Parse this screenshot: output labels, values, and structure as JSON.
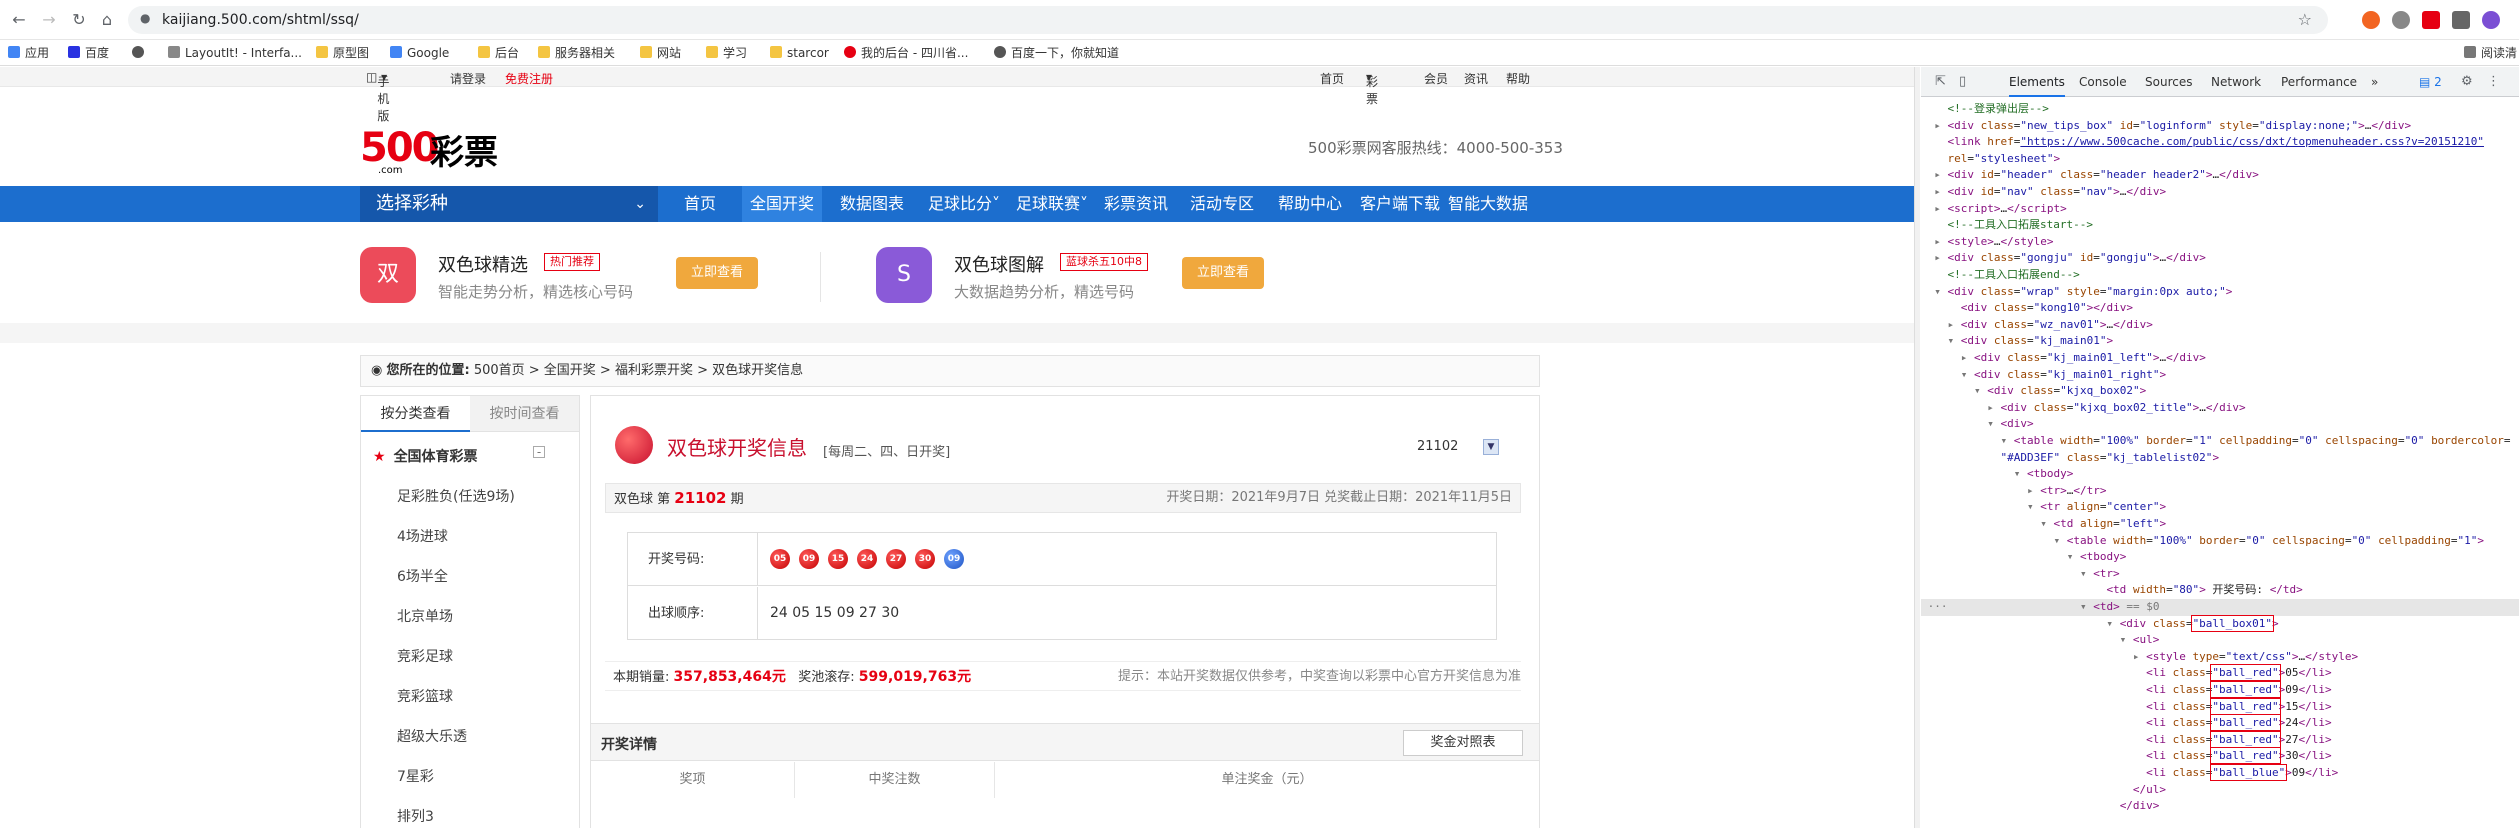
{
  "browser": {
    "url": "kaijiang.500.com/shtml/ssq/",
    "bookmarks": [
      {
        "label": "应用",
        "color": "#4285f4"
      },
      {
        "label": "百度",
        "color": "#2932e1"
      },
      {
        "label": "",
        "color": "#555555"
      },
      {
        "label": "LayoutIt! - Interfa...",
        "color": "#888888"
      },
      {
        "label": "原型图",
        "color": "#f4c542"
      },
      {
        "label": "Google",
        "color": "#4285f4"
      },
      {
        "label": "后台",
        "color": "#f4c542"
      },
      {
        "label": "服务器相关",
        "color": "#f4c542"
      },
      {
        "label": "网站",
        "color": "#f4c542"
      },
      {
        "label": "学习",
        "color": "#f4c542"
      },
      {
        "label": "starcor",
        "color": "#f4c542"
      },
      {
        "label": "我的后台 - 四川省...",
        "color": "#e60012"
      },
      {
        "label": "百度一下，你就知道",
        "color": "#555555"
      },
      {
        "label": "阅读清",
        "color": "#777777"
      }
    ]
  },
  "site": {
    "topbar": {
      "mobile": "手机版",
      "login": "请登录",
      "register": "免费注册",
      "links": [
        "首页",
        "彩票",
        "会员",
        "资讯",
        "帮助"
      ]
    },
    "logo_num": "500",
    "logo_com": ".com",
    "logo_text": "彩票",
    "hotline": "500彩票网客服热线：4000-500-353",
    "nav": {
      "select_label": "选择彩种",
      "items": [
        "首页",
        "全国开奖",
        "数据图表",
        "足球比分",
        "足球联赛",
        "彩票资讯",
        "活动专区",
        "帮助中心",
        "客户端下载",
        "智能大数据"
      ]
    },
    "promos": [
      {
        "title": "双色球精选",
        "tag": "热门推荐",
        "desc": "智能走势分析，精选核心号码",
        "button": "立即查看",
        "icon": "双"
      },
      {
        "title": "双色球图解",
        "tag": "蓝球杀五10中8",
        "desc": "大数据趋势分析，精选号码",
        "button": "立即查看",
        "icon": "S"
      }
    ],
    "breadcrumb": {
      "prefix": "您所在的位置:",
      "path": "500首页 > 全国开奖 > 福利彩票开奖 > 双色球开奖信息"
    },
    "sidebar": {
      "tabs": [
        "按分类查看",
        "按时间查看"
      ],
      "head": "全国体育彩票",
      "items": [
        "足彩胜负(任选9场)",
        "4场进球",
        "6场半全",
        "北京单场",
        "竞彩足球",
        "竞彩篮球",
        "超级大乐透",
        "7星彩",
        "排列3"
      ]
    },
    "draw": {
      "title": "双色球开奖信息",
      "days": "[每周二、四、日开奖]",
      "period_select": "21102",
      "period_prefix": "双色球 第",
      "period": "21102",
      "period_suffix": "期",
      "dates": "开奖日期：2021年9月7日 兑奖截止日期：2021年11月5日",
      "numbers_label": "开奖号码:",
      "red_balls": [
        "05",
        "09",
        "15",
        "24",
        "27",
        "30"
      ],
      "blue_ball": "09",
      "order_label": "出球顺序:",
      "order": "24 05 15 09 27 30",
      "sales_label": "本期销量:",
      "sales": "357,853,464元",
      "pool_label": "奖池滚存:",
      "pool": "599,019,763元",
      "notice": "提示：本站开奖数据仅供参考，中奖查询以彩票中心官方开奖信息为准",
      "detail_title": "开奖详情",
      "compare_btn": "奖金对照表",
      "detail_cols": [
        "奖项",
        "中奖注数",
        "单注奖金（元）"
      ]
    }
  },
  "devtools": {
    "tabs": [
      "Elements",
      "Console",
      "Sources",
      "Network",
      "Performance",
      "»"
    ],
    "badge": "2"
  }
}
